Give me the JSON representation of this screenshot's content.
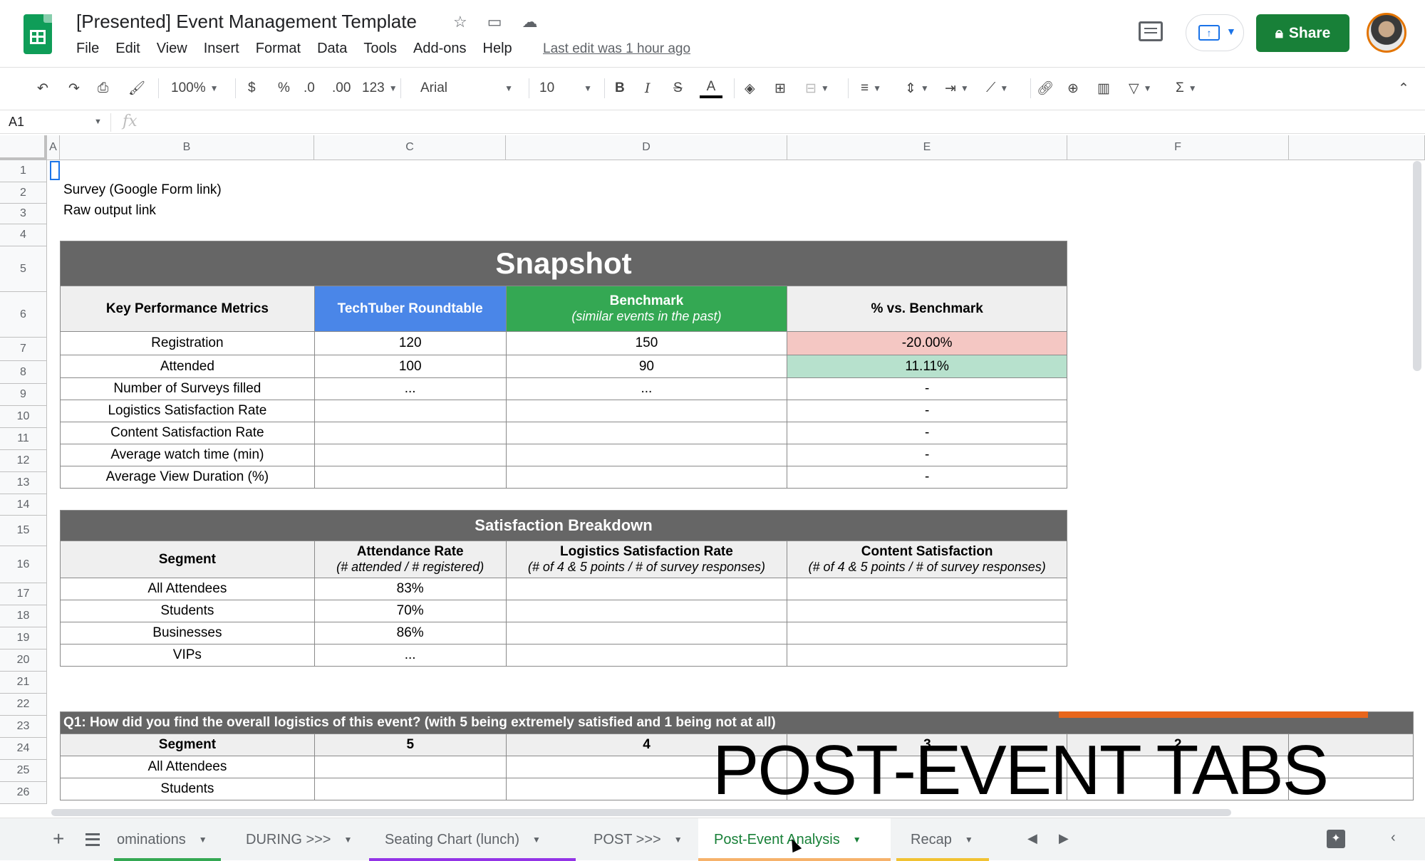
{
  "header": {
    "doc_title": "[Presented] Event Management Template",
    "menus": [
      "File",
      "Edit",
      "View",
      "Insert",
      "Format",
      "Data",
      "Tools",
      "Add-ons",
      "Help"
    ],
    "last_edit": "Last edit was 1 hour ago",
    "share_label": "Share"
  },
  "toolbar": {
    "zoom": "100%",
    "currency": "$",
    "percent": "%",
    "dec_decrease": ".0",
    "dec_increase": ".00",
    "more_formats": "123",
    "font": "Arial",
    "font_size": "10",
    "bold": "B",
    "italic": "I",
    "strike": "S",
    "text_color": "A"
  },
  "formula_bar": {
    "cell_ref": "A1",
    "fx": "fx"
  },
  "columns": [
    "A",
    "B",
    "C",
    "D",
    "E",
    "F"
  ],
  "rows": [
    "1",
    "2",
    "3",
    "4",
    "5",
    "6",
    "7",
    "8",
    "9",
    "10",
    "11",
    "12",
    "13",
    "14",
    "15",
    "16",
    "17",
    "18",
    "19",
    "20",
    "21",
    "22",
    "23",
    "24",
    "25",
    "26"
  ],
  "cells": {
    "b2": "Survey (Google Form link)",
    "b3": "Raw output link"
  },
  "snapshot": {
    "title": "Snapshot",
    "headers": {
      "metric": "Key Performance Metrics",
      "event": "TechTuber Roundtable",
      "benchmark": "Benchmark",
      "benchmark_sub": "(similar events in the past)",
      "pct": "% vs. Benchmark"
    },
    "rows": [
      {
        "metric": "Registration",
        "event": "120",
        "benchmark": "150",
        "pct": "-20.00%"
      },
      {
        "metric": "Attended",
        "event": "100",
        "benchmark": "90",
        "pct": "11.11%"
      },
      {
        "metric": "Number of Surveys filled",
        "event": "...",
        "benchmark": "...",
        "pct": "-"
      },
      {
        "metric": "Logistics Satisfaction Rate",
        "event": "",
        "benchmark": "",
        "pct": "-"
      },
      {
        "metric": "Content Satisfaction Rate",
        "event": "",
        "benchmark": "",
        "pct": "-"
      },
      {
        "metric": "Average watch time (min)",
        "event": "",
        "benchmark": "",
        "pct": "-"
      },
      {
        "metric": "Average View Duration (%)",
        "event": "",
        "benchmark": "",
        "pct": "-"
      }
    ]
  },
  "satisfaction": {
    "title": "Satisfaction Breakdown",
    "headers": {
      "segment": "Segment",
      "attendance": "Attendance Rate",
      "attendance_sub": "(# attended / # registered)",
      "logistics": "Logistics Satisfaction Rate",
      "logistics_sub": "(# of 4 & 5 points / # of survey responses)",
      "content": "Content Satisfaction",
      "content_sub": "(# of 4 & 5 points / # of survey responses)"
    },
    "rows": [
      {
        "segment": "All Attendees",
        "attendance": "83%"
      },
      {
        "segment": "Students",
        "attendance": "70%"
      },
      {
        "segment": "Businesses",
        "attendance": "86%"
      },
      {
        "segment": "VIPs",
        "attendance": "..."
      }
    ]
  },
  "q1": {
    "title": "Q1: How did you find the overall logistics of this event? (with 5 being extremely satisfied and 1 being not at all)",
    "headers": [
      "Segment",
      "5",
      "4",
      "3",
      "2"
    ],
    "rows": [
      "All Attendees",
      "Students"
    ]
  },
  "overlay": {
    "text": "POST-EVENT TABS"
  },
  "tabs": [
    {
      "label": "ominations",
      "color": "#34a853"
    },
    {
      "label": "DURING >>>",
      "color": ""
    },
    {
      "label": "Seating Chart (lunch)",
      "color": "#9334e6"
    },
    {
      "label": "POST >>>",
      "color": ""
    },
    {
      "label": "Post-Event Analysis",
      "color": "#f6b26b",
      "active": true
    },
    {
      "label": "Recap",
      "color": "#f1c232"
    }
  ]
}
